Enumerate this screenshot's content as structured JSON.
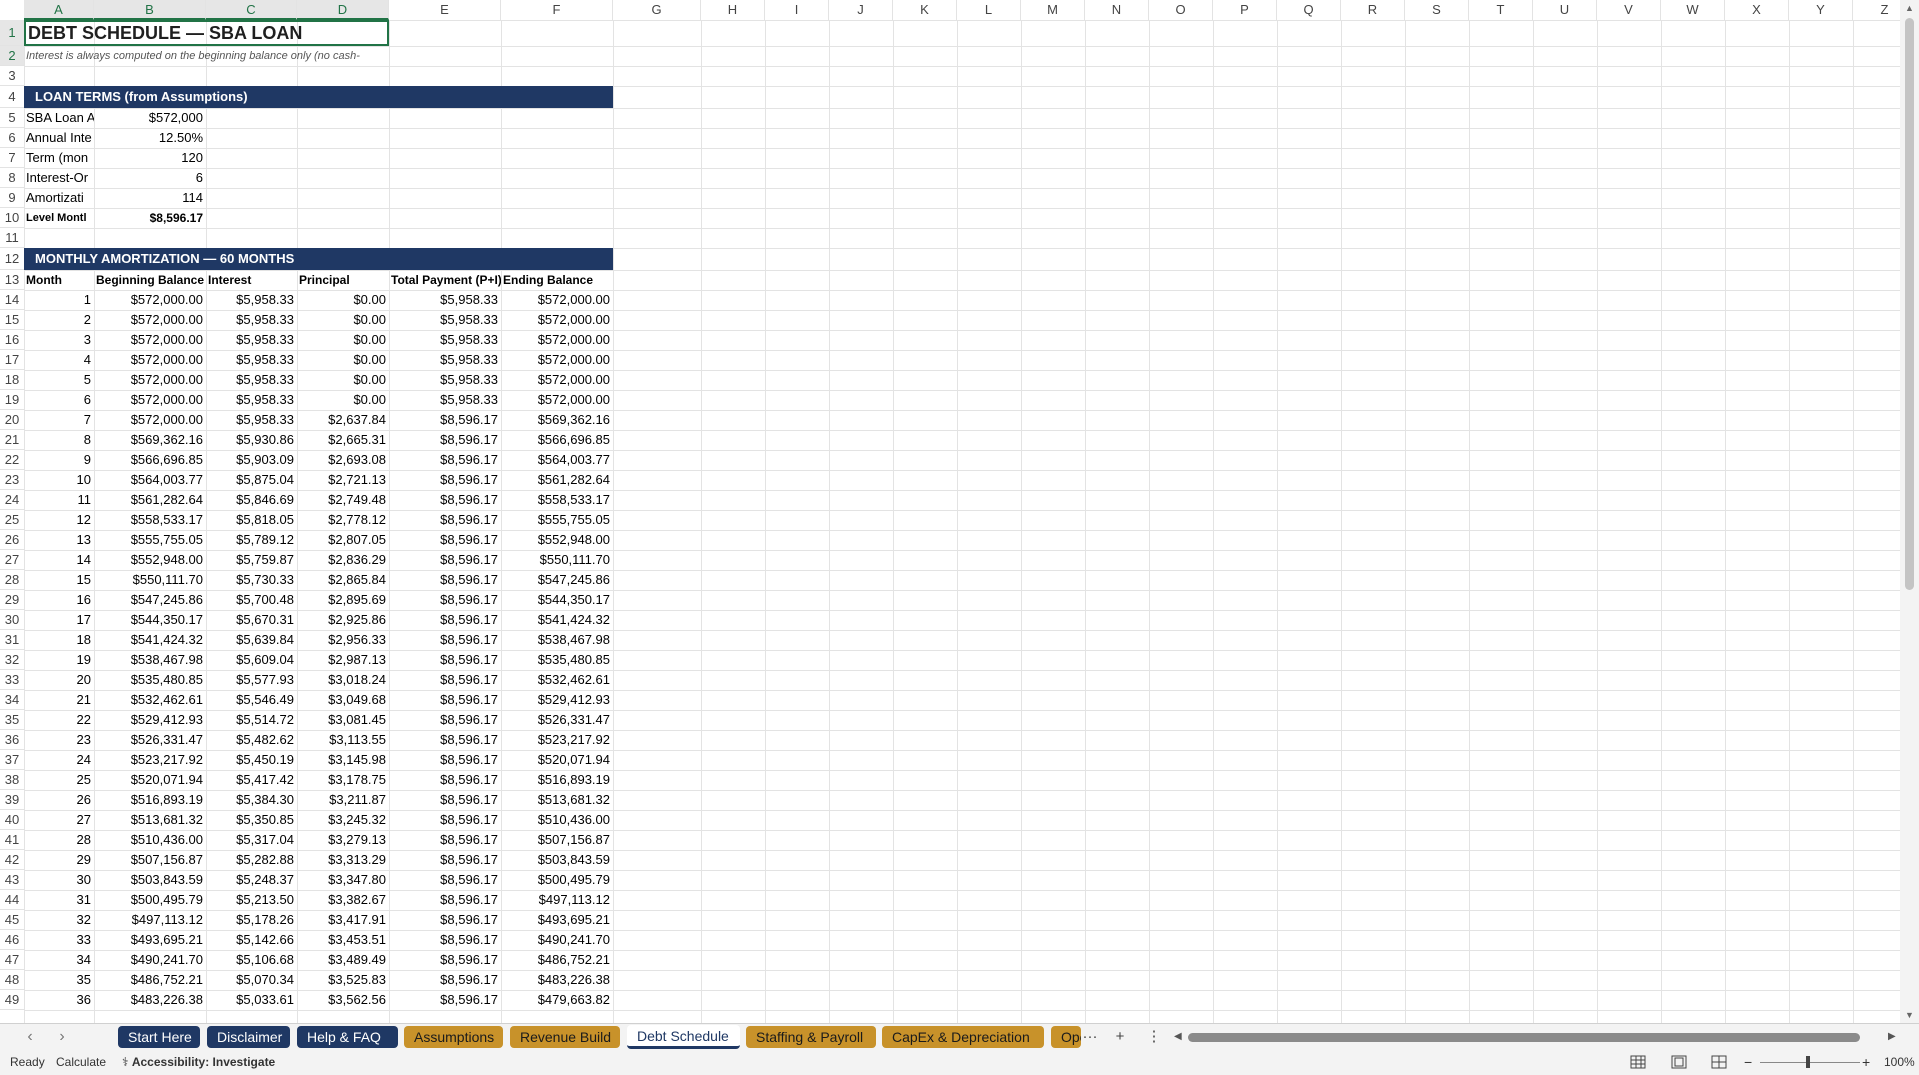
{
  "columns": [
    "A",
    "B",
    "C",
    "D",
    "E",
    "F",
    "G",
    "H",
    "I",
    "J",
    "K",
    "L",
    "M",
    "N",
    "O",
    "P",
    "Q",
    "R",
    "S",
    "T",
    "U",
    "V",
    "W",
    "X",
    "Y",
    "Z"
  ],
  "rows": [
    1,
    2,
    3,
    4,
    5,
    6,
    7,
    8,
    9,
    10,
    11,
    12,
    13,
    14,
    15,
    16,
    17,
    18,
    19,
    20,
    21,
    22,
    23,
    24,
    25,
    26,
    27,
    28,
    29,
    30,
    31,
    32,
    33,
    34,
    35,
    36,
    37,
    38,
    39,
    40,
    41,
    42,
    43,
    44,
    45,
    46,
    47,
    48,
    49
  ],
  "title": "DEBT SCHEDULE — SBA LOAN",
  "note": "Interest is always computed on the beginning balance only (no cash-",
  "loan_terms": {
    "banner": "LOAN TERMS (from Assumptions)",
    "items": [
      {
        "label": "SBA Loan A",
        "value": "$572,000"
      },
      {
        "label": "Annual Inte",
        "value": "12.50%"
      },
      {
        "label": "Term (mon",
        "value": "120"
      },
      {
        "label": "Interest-Or",
        "value": "6"
      },
      {
        "label": "Amortizati",
        "value": "114"
      },
      {
        "label": "Level Montl",
        "value": "$8,596.17"
      }
    ]
  },
  "amortization": {
    "banner": "MONTHLY AMORTIZATION — 60 MONTHS",
    "headers": [
      "Month",
      "Beginning Balance",
      "Interest",
      "Principal",
      "Total Payment (P+I)",
      "Ending Balance"
    ],
    "rows": [
      [
        "1",
        "$572,000.00",
        "$5,958.33",
        "$0.00",
        "$5,958.33",
        "$572,000.00"
      ],
      [
        "2",
        "$572,000.00",
        "$5,958.33",
        "$0.00",
        "$5,958.33",
        "$572,000.00"
      ],
      [
        "3",
        "$572,000.00",
        "$5,958.33",
        "$0.00",
        "$5,958.33",
        "$572,000.00"
      ],
      [
        "4",
        "$572,000.00",
        "$5,958.33",
        "$0.00",
        "$5,958.33",
        "$572,000.00"
      ],
      [
        "5",
        "$572,000.00",
        "$5,958.33",
        "$0.00",
        "$5,958.33",
        "$572,000.00"
      ],
      [
        "6",
        "$572,000.00",
        "$5,958.33",
        "$0.00",
        "$5,958.33",
        "$572,000.00"
      ],
      [
        "7",
        "$572,000.00",
        "$5,958.33",
        "$2,637.84",
        "$8,596.17",
        "$569,362.16"
      ],
      [
        "8",
        "$569,362.16",
        "$5,930.86",
        "$2,665.31",
        "$8,596.17",
        "$566,696.85"
      ],
      [
        "9",
        "$566,696.85",
        "$5,903.09",
        "$2,693.08",
        "$8,596.17",
        "$564,003.77"
      ],
      [
        "10",
        "$564,003.77",
        "$5,875.04",
        "$2,721.13",
        "$8,596.17",
        "$561,282.64"
      ],
      [
        "11",
        "$561,282.64",
        "$5,846.69",
        "$2,749.48",
        "$8,596.17",
        "$558,533.17"
      ],
      [
        "12",
        "$558,533.17",
        "$5,818.05",
        "$2,778.12",
        "$8,596.17",
        "$555,755.05"
      ],
      [
        "13",
        "$555,755.05",
        "$5,789.12",
        "$2,807.05",
        "$8,596.17",
        "$552,948.00"
      ],
      [
        "14",
        "$552,948.00",
        "$5,759.87",
        "$2,836.29",
        "$8,596.17",
        "$550,111.70"
      ],
      [
        "15",
        "$550,111.70",
        "$5,730.33",
        "$2,865.84",
        "$8,596.17",
        "$547,245.86"
      ],
      [
        "16",
        "$547,245.86",
        "$5,700.48",
        "$2,895.69",
        "$8,596.17",
        "$544,350.17"
      ],
      [
        "17",
        "$544,350.17",
        "$5,670.31",
        "$2,925.86",
        "$8,596.17",
        "$541,424.32"
      ],
      [
        "18",
        "$541,424.32",
        "$5,639.84",
        "$2,956.33",
        "$8,596.17",
        "$538,467.98"
      ],
      [
        "19",
        "$538,467.98",
        "$5,609.04",
        "$2,987.13",
        "$8,596.17",
        "$535,480.85"
      ],
      [
        "20",
        "$535,480.85",
        "$5,577.93",
        "$3,018.24",
        "$8,596.17",
        "$532,462.61"
      ],
      [
        "21",
        "$532,462.61",
        "$5,546.49",
        "$3,049.68",
        "$8,596.17",
        "$529,412.93"
      ],
      [
        "22",
        "$529,412.93",
        "$5,514.72",
        "$3,081.45",
        "$8,596.17",
        "$526,331.47"
      ],
      [
        "23",
        "$526,331.47",
        "$5,482.62",
        "$3,113.55",
        "$8,596.17",
        "$523,217.92"
      ],
      [
        "24",
        "$523,217.92",
        "$5,450.19",
        "$3,145.98",
        "$8,596.17",
        "$520,071.94"
      ],
      [
        "25",
        "$520,071.94",
        "$5,417.42",
        "$3,178.75",
        "$8,596.17",
        "$516,893.19"
      ],
      [
        "26",
        "$516,893.19",
        "$5,384.30",
        "$3,211.87",
        "$8,596.17",
        "$513,681.32"
      ],
      [
        "27",
        "$513,681.32",
        "$5,350.85",
        "$3,245.32",
        "$8,596.17",
        "$510,436.00"
      ],
      [
        "28",
        "$510,436.00",
        "$5,317.04",
        "$3,279.13",
        "$8,596.17",
        "$507,156.87"
      ],
      [
        "29",
        "$507,156.87",
        "$5,282.88",
        "$3,313.29",
        "$8,596.17",
        "$503,843.59"
      ],
      [
        "30",
        "$503,843.59",
        "$5,248.37",
        "$3,347.80",
        "$8,596.17",
        "$500,495.79"
      ],
      [
        "31",
        "$500,495.79",
        "$5,213.50",
        "$3,382.67",
        "$8,596.17",
        "$497,113.12"
      ],
      [
        "32",
        "$497,113.12",
        "$5,178.26",
        "$3,417.91",
        "$8,596.17",
        "$493,695.21"
      ],
      [
        "33",
        "$493,695.21",
        "$5,142.66",
        "$3,453.51",
        "$8,596.17",
        "$490,241.70"
      ],
      [
        "34",
        "$490,241.70",
        "$5,106.68",
        "$3,489.49",
        "$8,596.17",
        "$486,752.21"
      ],
      [
        "35",
        "$486,752.21",
        "$5,070.34",
        "$3,525.83",
        "$8,596.17",
        "$483,226.38"
      ],
      [
        "36",
        "$483,226.38",
        "$5,033.61",
        "$3,562.56",
        "$8,596.17",
        "$479,663.82"
      ]
    ]
  },
  "tabs": [
    {
      "label": "Start Here",
      "style": "navy"
    },
    {
      "label": "Disclaimer",
      "style": "navy"
    },
    {
      "label": "Help & FAQ",
      "style": "navy"
    },
    {
      "label": "Assumptions",
      "style": "gold"
    },
    {
      "label": "Revenue Build",
      "style": "gold"
    },
    {
      "label": "Debt Schedule",
      "style": "active"
    },
    {
      "label": "Staffing & Payroll",
      "style": "gold"
    },
    {
      "label": "CapEx & Depreciation",
      "style": "gold"
    },
    {
      "label": "Oper",
      "style": "gold"
    }
  ],
  "tab_controls": {
    "more": "···",
    "add": "+",
    "options": "⋮"
  },
  "status": {
    "ready": "Ready",
    "calculate": "Calculate",
    "accessibility": "Accessibility: Investigate",
    "zoom": "100%"
  },
  "colors": {
    "navy": "#1f3864",
    "gold": "#c8922a",
    "excel_green": "#217346"
  }
}
